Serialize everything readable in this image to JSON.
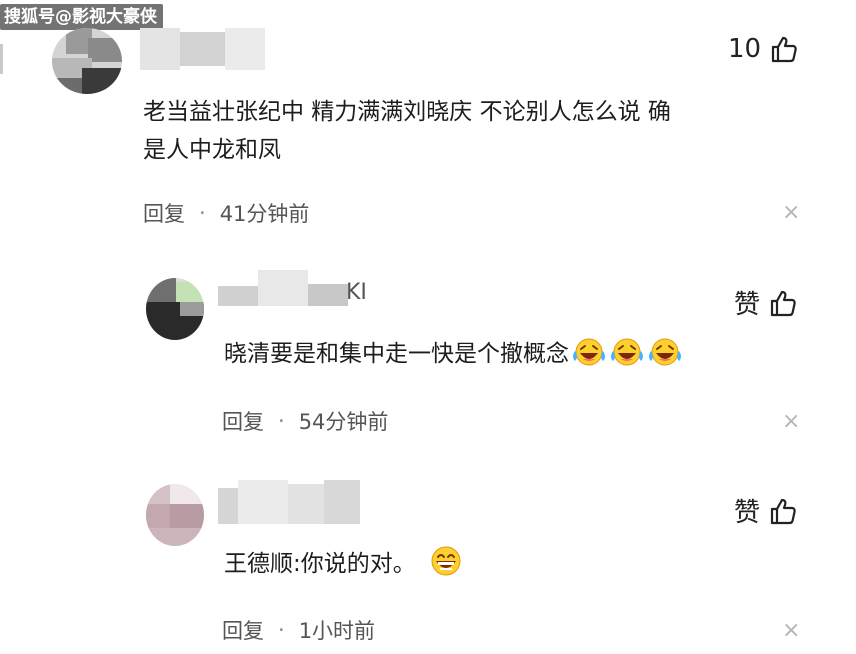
{
  "watermark": "搜狐号@影视大豪侠",
  "comments": [
    {
      "likes": "10",
      "text_line1": "老当益壮张纪中 精力满满刘晓庆 不论别人怎么说 确",
      "text_line2": "是人中龙和凤",
      "reply_label": "回复",
      "time": "41分钟前",
      "close": "×"
    },
    {
      "likes": "赞",
      "name_fragment": "KI",
      "text": "晓清要是和集中走一快是个撤概念",
      "emojis": [
        "laugh-cry-emoji",
        "laugh-cry-emoji",
        "laugh-cry-emoji"
      ],
      "reply_label": "回复",
      "time": "54分钟前",
      "close": "×"
    },
    {
      "likes": "赞",
      "text": "王德顺:你说的对。",
      "emojis": [
        "grin-emoji"
      ],
      "reply_label": "回复",
      "time": "1小时前",
      "close": "×"
    }
  ],
  "colors": {
    "text": "#1d1d1d",
    "meta": "#555555",
    "close": "#b5b5b5",
    "emoji_face": "#ffcf2e"
  }
}
